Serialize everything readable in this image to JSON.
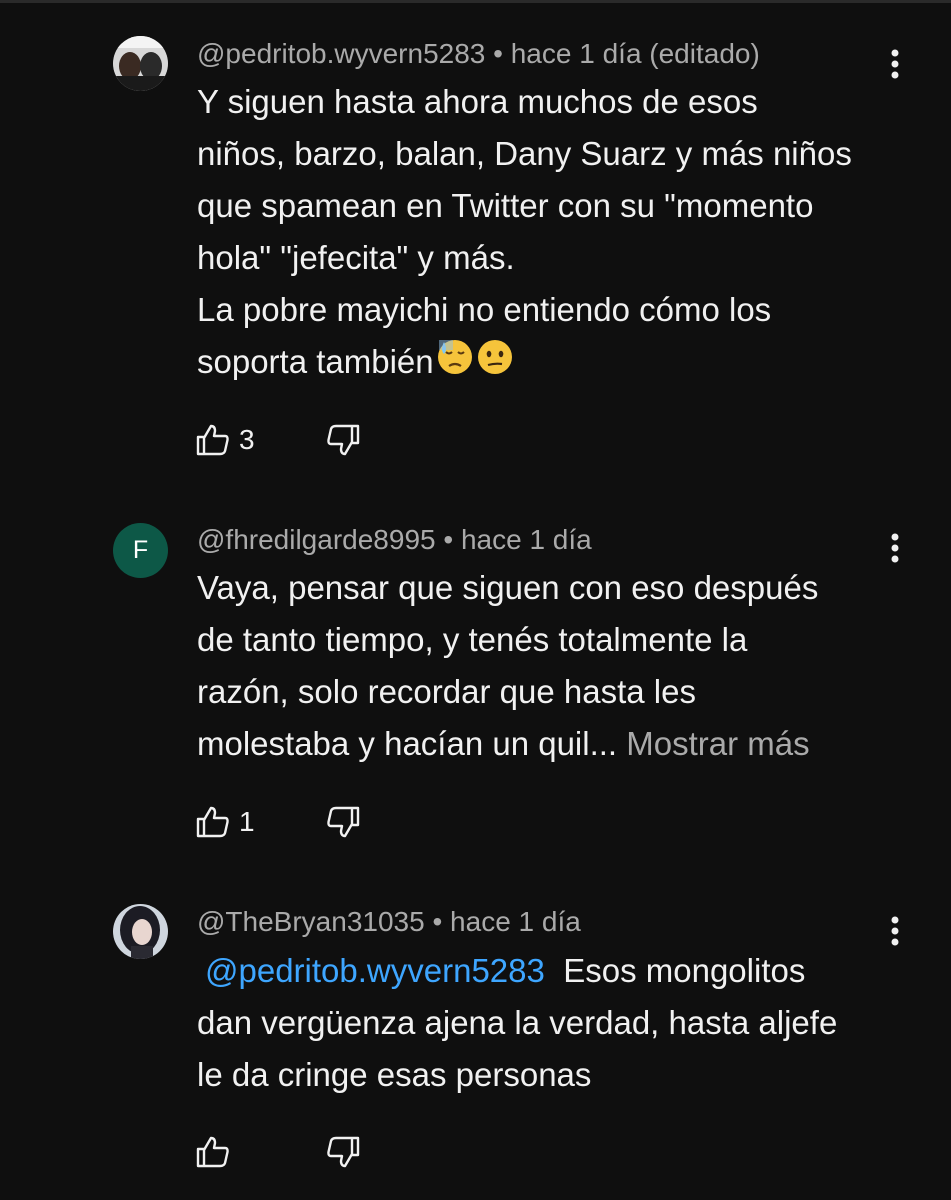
{
  "comments": [
    {
      "handle": "@pedritob.wyvern5283",
      "time": "• hace 1 día (editado)",
      "avatar_type": "photo",
      "lines": [
        "Y siguen hasta ahora muchos de esos",
        "niños, barzo, balan, Dany Suarz y más niños",
        "que spamean en Twitter con su \"momento",
        "hola\" \"jefecita\" y más.",
        "La pobre mayichi no entiendo cómo los",
        "soporta también"
      ],
      "emojis": [
        "downcast-face-with-sweat",
        "confused-face"
      ],
      "likes": "3"
    },
    {
      "handle": "@fhredilgarde8995",
      "time": "• hace 1 día",
      "avatar_letter": "F",
      "avatar_color": "#0d5847",
      "lines": [
        "Vaya, pensar que siguen con eso después",
        "de tanto tiempo, y tenés totalmente la",
        "razón, solo recordar que hasta les",
        "molestaba y hacían un quil..."
      ],
      "show_more": "Mostrar más",
      "likes": "1"
    },
    {
      "handle": "@TheBryan31035",
      "time": "• hace 1 día",
      "avatar_type": "photo",
      "mention": "@pedritob.wyvern5283",
      "lines": [
        "Esos mongolitos",
        "dan vergüenza ajena la verdad, hasta aljefe",
        "le da cringe esas personas"
      ]
    }
  ],
  "colors": {
    "background": "#0f0f0f",
    "text": "#f1f1f1",
    "meta": "#aaaaaa",
    "mention": "#3ea6ff"
  },
  "icons": {
    "like": "thumb-up-icon",
    "dislike": "thumb-down-icon",
    "menu": "more-vert-icon"
  }
}
